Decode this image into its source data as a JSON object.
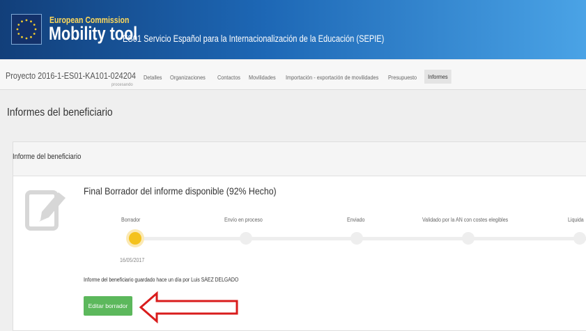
{
  "header": {
    "org": "European Commission",
    "app_title": "Mobility tool",
    "agency": "ES01 Servicio Español para la Internacionalización de la Educación (SEPIE)"
  },
  "project": {
    "id": "Proyecto 2016-1-ES01-KA101-024204",
    "status": "procesando"
  },
  "tabs": [
    {
      "label": "Detalles"
    },
    {
      "label": "Organizaciones"
    },
    {
      "label": "Contactos"
    },
    {
      "label": "Movilidades"
    },
    {
      "label": "Importación - exportación de movilidades"
    },
    {
      "label": "Presupuesto"
    },
    {
      "label": "Informes",
      "active": true
    }
  ],
  "page": {
    "title": "Informes del beneficiario"
  },
  "panel": {
    "title": "Informe del beneficiario",
    "report_status": "Final Borrador del informe disponible (92% Hecho)",
    "steps": [
      {
        "label": "Borrador"
      },
      {
        "label": "Envío en proceso"
      },
      {
        "label": "Enviado"
      },
      {
        "label": "Validado por la AN con costes elegibles"
      },
      {
        "label": "Liquida"
      }
    ],
    "active_step_date": "16/05/2017",
    "saved_note": "Informe del beneficiario guardado hace un día por Luis SÁEZ DELGADO",
    "edit_button": "Editar borrador"
  },
  "icons": {
    "eu_flag": "eu-flag-icon",
    "report": "edit-document-icon",
    "arrow": "red-left-arrow-icon"
  },
  "colors": {
    "header_blue": "#1d67b5",
    "eu_yellow": "#ffd95a",
    "active_step": "#f4c21d",
    "button_green": "#5cb85c",
    "arrow_red": "#d91c1c"
  }
}
